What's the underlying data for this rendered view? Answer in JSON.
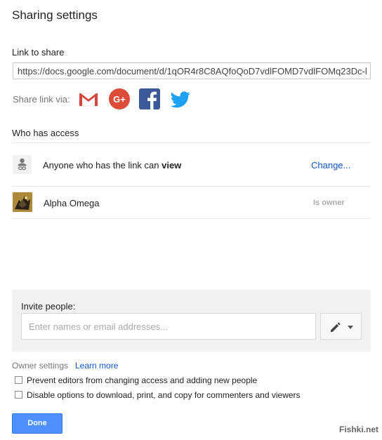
{
  "dialog": {
    "title": "Sharing settings"
  },
  "link": {
    "label": "Link to share",
    "url": "https://docs.google.com/document/d/1qOR4r8C8AQfoQoD7vdlFOMD7vdlFOMq23Dc-l"
  },
  "share_via": {
    "label": "Share link via:",
    "services": [
      {
        "name": "gmail",
        "icon": "gmail-icon",
        "color": "#d44638"
      },
      {
        "name": "google-plus",
        "icon": "google-plus-icon",
        "color": "#dd4b39"
      },
      {
        "name": "facebook",
        "icon": "facebook-icon",
        "color": "#3b5998"
      },
      {
        "name": "twitter",
        "icon": "twitter-icon",
        "color": "#1da1f2"
      }
    ]
  },
  "access": {
    "label": "Who has access",
    "link_row": {
      "icon": "link-person-icon",
      "text_prefix": "Anyone who has the link can ",
      "text_permission": "view",
      "change_label": "Change..."
    },
    "owner_row": {
      "icon": "avatar",
      "name": "Alpha Omega",
      "role": "Is owner"
    }
  },
  "invite": {
    "label": "Invite people:",
    "placeholder": "Enter names or email addresses...",
    "permission_icon": "pencil-icon"
  },
  "owner_settings": {
    "label": "Owner settings",
    "learn_more": "Learn more",
    "options": [
      {
        "label": "Prevent editors from changing access and adding new people",
        "checked": false
      },
      {
        "label": "Disable options to download, print, and copy for commenters and viewers",
        "checked": false
      }
    ]
  },
  "footer": {
    "done_label": "Done",
    "watermark": "Fishki.net"
  },
  "colors": {
    "link": "#1155cc",
    "primary_button": "#4d90fe"
  }
}
